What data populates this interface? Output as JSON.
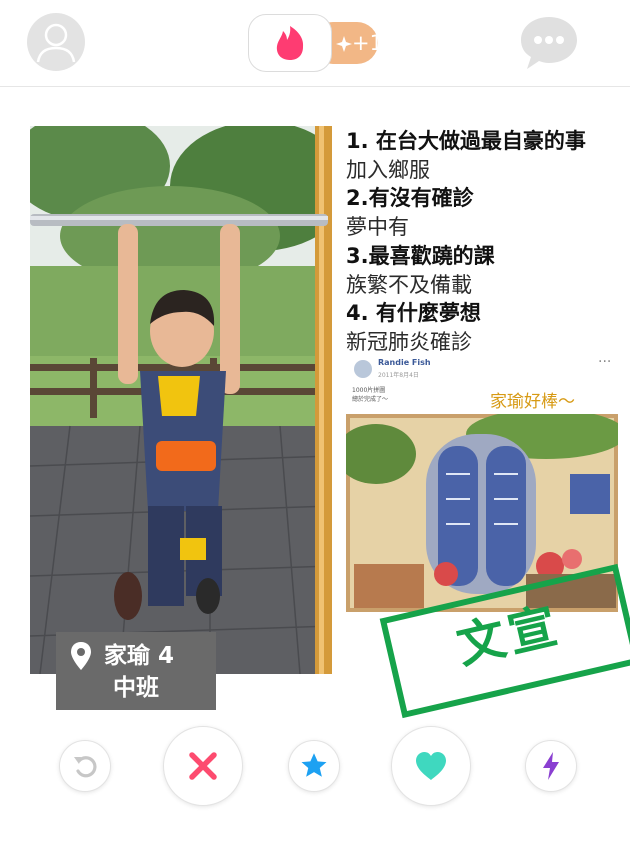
{
  "top_bar": {
    "profile_icon": "person-icon",
    "logo_icon": "flame-icon",
    "gold_badge": "+1",
    "gold_icon": "sparkle-icon",
    "chat_icon": "chat-bubble-icon"
  },
  "card": {
    "name_line": "家瑜 4",
    "grade": "中班",
    "location_icon": "map-pin-icon"
  },
  "bio": [
    {
      "question": "1. 在台大做過最自豪的事",
      "answer": "加入鄉服"
    },
    {
      "question": "2.有沒有確診",
      "answer": "夢中有"
    },
    {
      "question": "3.最喜歡蹺的課",
      "answer": "族繁不及備載"
    },
    {
      "question": "4. 有什麼夢想",
      "answer": "新冠肺炎確診"
    }
  ],
  "post": {
    "author": "Randie Fish",
    "date": "2011年8月4日",
    "line1": "1000片拼圖",
    "line2": "總於完成了～",
    "menu": "···",
    "praise": "家瑜好棒～"
  },
  "stamp": {
    "text": "文宣"
  },
  "actions": {
    "rewind": "rewind-icon",
    "nope": "close-x-icon",
    "superlike": "star-icon",
    "like": "heart-icon",
    "boost": "lightning-icon"
  },
  "colors": {
    "brand": "#fe3c72",
    "gold": "#f2b786",
    "nope": "#fd4b6f",
    "superlike": "#1da1f2",
    "like": "#3fd8bf",
    "boost": "#8a3fd1",
    "stamp": "#16a34a",
    "praise": "#d79a14"
  }
}
